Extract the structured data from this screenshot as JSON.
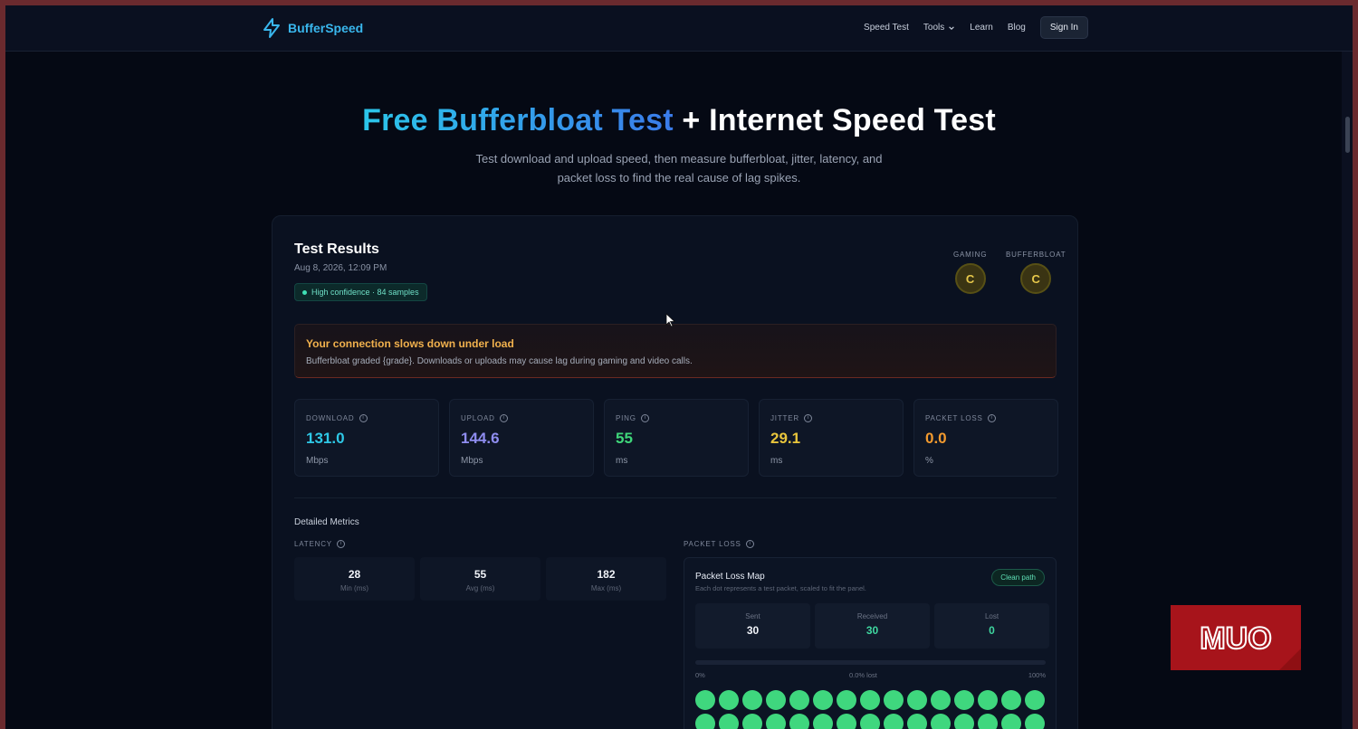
{
  "nav": {
    "brand": "BufferSpeed",
    "links": [
      "Speed Test",
      "Tools",
      "Learn",
      "Blog"
    ],
    "sign_in": "Sign In"
  },
  "hero": {
    "title_highlight": "Free Bufferbloat Test",
    "title_rest": " + Internet Speed Test",
    "subtitle_line1": "Test download and upload speed, then measure bufferbloat, jitter, latency, and",
    "subtitle_line2": "packet loss to find the real cause of lag spikes."
  },
  "results": {
    "title": "Test Results",
    "date": "Aug 8, 2026, 12:09 PM",
    "confidence": "High confidence · 84 samples",
    "grades": [
      {
        "label": "GAMING",
        "value": "C"
      },
      {
        "label": "BUFFERBLOAT",
        "value": "C"
      }
    ],
    "alert": {
      "title": "Your connection slows down under load",
      "text": "Bufferbloat graded {grade}. Downloads or uploads may cause lag during gaming and video calls."
    },
    "metrics": [
      {
        "label": "DOWNLOAD",
        "value": "131.0",
        "unit": "Mbps",
        "color": "#2ec8e6"
      },
      {
        "label": "UPLOAD",
        "value": "144.6",
        "unit": "Mbps",
        "color": "#8f8df0"
      },
      {
        "label": "PING",
        "value": "55",
        "unit": "ms",
        "color": "#3fd67a"
      },
      {
        "label": "JITTER",
        "value": "29.1",
        "unit": "ms",
        "color": "#e8c53c"
      },
      {
        "label": "PACKET LOSS",
        "value": "0.0",
        "unit": "%",
        "color": "#f29a2e"
      }
    ],
    "detailed_title": "Detailed Metrics",
    "latency": {
      "label": "LATENCY",
      "items": [
        {
          "value": "28",
          "caption": "Min (ms)"
        },
        {
          "value": "55",
          "caption": "Avg (ms)"
        },
        {
          "value": "182",
          "caption": "Max (ms)"
        }
      ]
    },
    "packet_loss": {
      "label": "PACKET LOSS",
      "map_title": "Packet Loss Map",
      "map_sub": "Each dot represents a test packet, scaled to fit the panel.",
      "badge": "Clean path",
      "stats": [
        {
          "caption": "Sent",
          "value": "30",
          "color": "#f0f3f8"
        },
        {
          "caption": "Received",
          "value": "30",
          "color": "#3fd7a0"
        },
        {
          "caption": "Lost",
          "value": "0",
          "color": "#3fd7a0"
        }
      ],
      "scale_left": "0%",
      "scale_mid": "0.0% lost",
      "scale_right": "100%",
      "packets_received": 30
    }
  },
  "icons": {
    "logo": "lightning-bolt-icon",
    "info": "info-circle-icon",
    "chevron": "chevron-down-icon",
    "cursor": "mouse-pointer-icon"
  },
  "watermark": "MUO"
}
